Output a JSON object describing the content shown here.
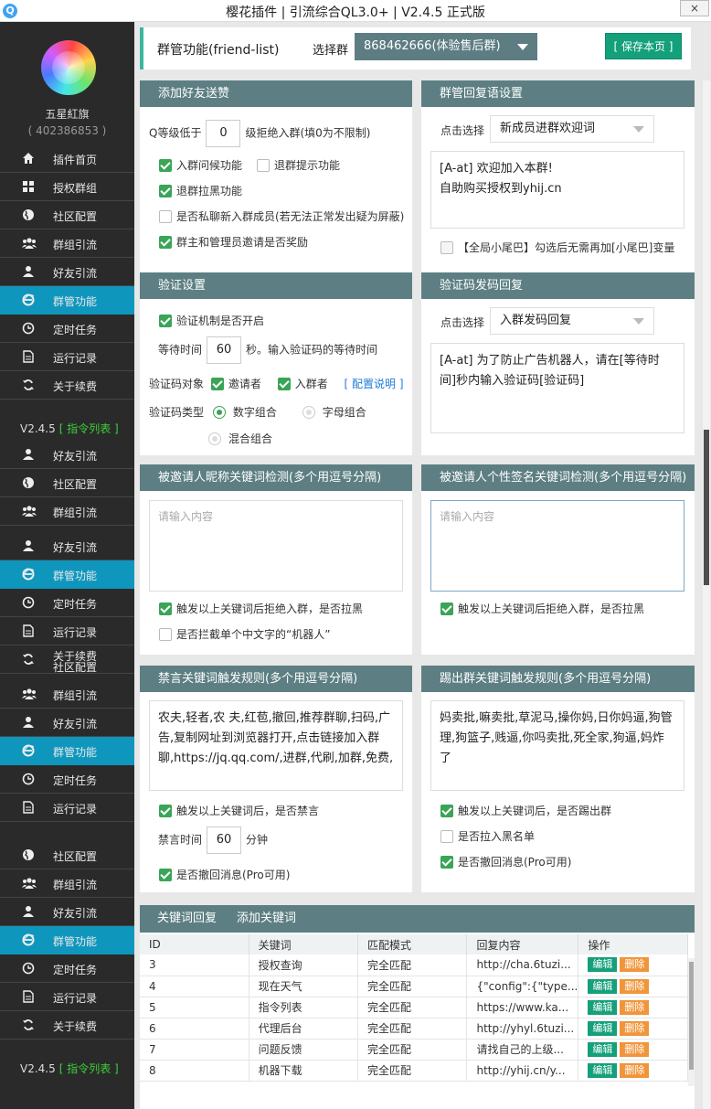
{
  "window": {
    "title": "樱花插件 | 引流综合QL3.0+ | V2.4.5 正式版",
    "close": "×"
  },
  "user": {
    "name": "五星紅旗",
    "qq": "( 402386853 )"
  },
  "sidebar": {
    "items": [
      {
        "label": "插件首页",
        "icon": "home-icon"
      },
      {
        "label": "授权群组",
        "icon": "grid-icon"
      },
      {
        "label": "社区配置",
        "icon": "globe-icon"
      },
      {
        "label": "群组引流",
        "icon": "users-icon"
      },
      {
        "label": "好友引流",
        "icon": "user-icon"
      },
      {
        "label": "群管功能",
        "icon": "ie-icon"
      },
      {
        "label": "定时任务",
        "icon": "clock-icon"
      },
      {
        "label": "运行记录",
        "icon": "file-icon"
      },
      {
        "label": "关于续费",
        "icon": "refresh-icon"
      }
    ],
    "version": "V2.4.5",
    "cmd_list": "[ 指令列表 ]",
    "repeat": [
      {
        "label": "好友引流"
      },
      {
        "label": "社区配置"
      },
      {
        "label": "群组引流"
      },
      {
        "label": "好友引流"
      },
      {
        "label": "群管功能"
      },
      {
        "label": "定时任务"
      },
      {
        "label": "运行记录"
      },
      {
        "label": "关于续费",
        "label2": "社区配置"
      },
      {
        "label": "群组引流"
      },
      {
        "label": "好友引流"
      },
      {
        "label": "群管功能"
      },
      {
        "label": "定时任务"
      },
      {
        "label": "运行记录"
      },
      {
        "label": "社区配置"
      },
      {
        "label": "群组引流"
      },
      {
        "label": "好友引流"
      },
      {
        "label": "群管功能"
      },
      {
        "label": "定时任务"
      },
      {
        "label": "运行记录"
      },
      {
        "label": "关于续费"
      }
    ]
  },
  "header": {
    "title": "群管功能(friend-list)",
    "group_label": "选择群",
    "group_value": "868462666(体验售后群)",
    "save": "[ 保存本页 ]"
  },
  "add_friend": {
    "title": "添加好友送赞",
    "level_prefix": "Q等级低于",
    "level_value": "0",
    "level_suffix": "级拒绝入群(填0为不限制)",
    "opt1": "入群问候功能",
    "opt2": "退群提示功能",
    "opt3": "退群拉黑功能",
    "opt4": "是否私聊新入群成员(若无法正常发出疑为屏蔽)",
    "opt5": "群主和管理员邀请是否奖励"
  },
  "reply": {
    "title": "群管回复语设置",
    "click_label": "点击选择",
    "select_value": "新成员进群欢迎词",
    "text_line1": "[A-at] 欢迎加入本群!",
    "text_line2": "自助购买授权到yhij.cn",
    "tail_opt": "【全局小尾巴】勾选后无需再加[小尾巴]变量"
  },
  "verify": {
    "title": "验证设置",
    "enable": "验证机制是否开启",
    "wait_label": "等待时间",
    "wait_value": "60",
    "wait_suffix": "秒。输入验证码的等待时间",
    "target_label": "验证码对象",
    "target1": "邀请者",
    "target2": "入群者",
    "config_link": "[ 配置说明 ]",
    "type_label": "验证码类型",
    "type1": "数字组合",
    "type2": "字母组合",
    "type3": "混合组合"
  },
  "code_reply": {
    "title": "验证码发码回复",
    "click_label": "点击选择",
    "select_value": "入群发码回复",
    "text": "[A-at] 为了防止广告机器人，请在[等待时间]秒内输入验证码[验证码]"
  },
  "nick_check": {
    "title": "被邀请人昵称关键词检测(多个用逗号分隔)",
    "placeholder": "请输入内容",
    "opt1": "触发以上关键词后拒绝入群，是否拉黑",
    "opt2": "是否拦截单个中文字的“机器人”"
  },
  "sign_check": {
    "title": "被邀请人个性签名关键词检测(多个用逗号分隔)",
    "placeholder": "请输入内容",
    "opt1": "触发以上关键词后拒绝入群，是否拉黑"
  },
  "mute_rule": {
    "title": "禁言关键词触发规则(多个用逗号分隔)",
    "text": "农夫,轻者,农 夫,红苞,撤回,推荐群聊,扫码,广告,复制网址到浏览器打开,点击链接加入群聊,https://jq.qq.com/,进群,代刷,加群,免费,",
    "opt1": "触发以上关键词后，是否禁言",
    "time_label": "禁言时间",
    "time_value": "60",
    "time_unit": "分钟",
    "opt2": "是否撤回消息(Pro可用)"
  },
  "kick_rule": {
    "title": "踢出群关键词触发规则(多个用逗号分隔)",
    "text": "妈卖批,嘛卖批,草泥马,操你妈,日你妈逼,狗管理,狗篮子,贱逼,你吗卖批,死全家,狗逼,妈炸了",
    "opt1": "触发以上关键词后，是否踢出群",
    "opt2": "是否拉入黑名单",
    "opt3": "是否撤回消息(Pro可用)"
  },
  "keywords": {
    "title": "关键词回复",
    "add": "添加关键词",
    "columns": [
      "ID",
      "关键词",
      "匹配模式",
      "回复内容",
      "操作"
    ],
    "edit": "编辑",
    "delete": "删除",
    "rows": [
      {
        "id": "3",
        "kw": "授权查询",
        "mode": "完全匹配",
        "reply": "http://cha.6tuzi..."
      },
      {
        "id": "4",
        "kw": "现在天气",
        "mode": "完全匹配",
        "reply": "{\"config\":{\"type..."
      },
      {
        "id": "5",
        "kw": "指令列表",
        "mode": "完全匹配",
        "reply": "https://www.ka..."
      },
      {
        "id": "6",
        "kw": "代理后台",
        "mode": "完全匹配",
        "reply": "http://yhyl.6tuzi..."
      },
      {
        "id": "7",
        "kw": "问题反馈",
        "mode": "完全匹配",
        "reply": "请找自己的上级..."
      },
      {
        "id": "8",
        "kw": "机器下载",
        "mode": "完全匹配",
        "reply": "http://yhij.cn/y..."
      }
    ]
  }
}
